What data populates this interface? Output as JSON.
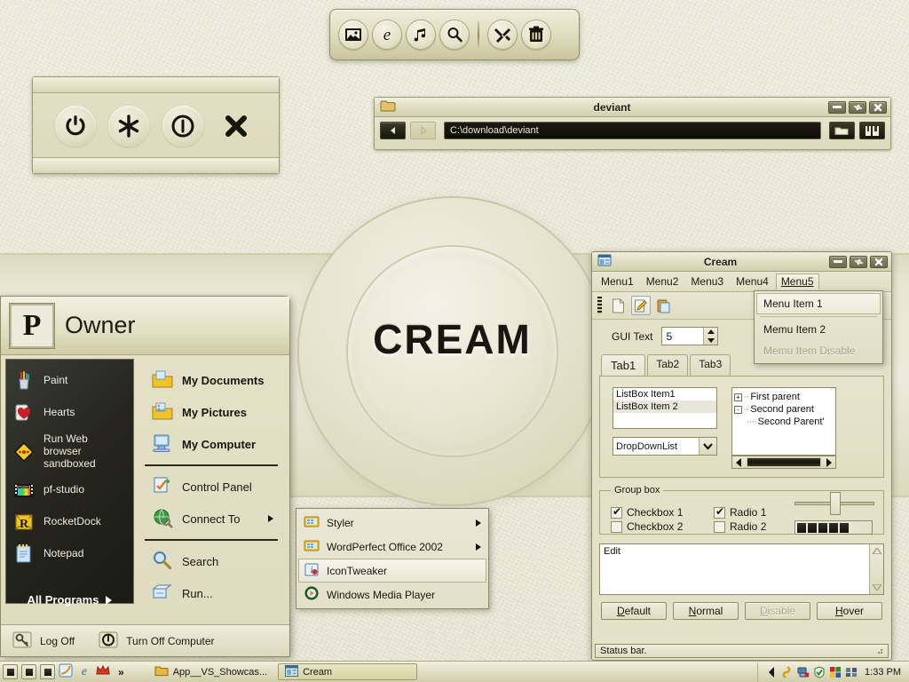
{
  "desktop": {
    "wallpaper_title": "CREAM",
    "bg_color": "#e8e6d2",
    "accent_color": "#d2cfac"
  },
  "dock": {
    "name": "icon-dock",
    "buttons": [
      {
        "name": "pictures-icon",
        "label": "Pictures"
      },
      {
        "name": "internet-explorer-icon",
        "label": "Internet"
      },
      {
        "name": "music-note-icon",
        "label": "Music"
      },
      {
        "name": "search-magnifier-icon",
        "label": "Search"
      },
      {
        "name": "tools-icon",
        "label": "Tools"
      },
      {
        "name": "trash-icon",
        "label": "Recycle Bin"
      }
    ]
  },
  "power_panel": {
    "buttons": [
      {
        "name": "power-icon",
        "label": "Shut Down"
      },
      {
        "name": "asterisk-icon",
        "label": "Hibernate"
      },
      {
        "name": "standby-icon",
        "label": "Stand By"
      },
      {
        "name": "close-x-icon",
        "label": "Cancel"
      }
    ]
  },
  "deviant_window": {
    "title": "deviant",
    "folder_icon": "folder-icon",
    "address_value": "C:\\download\\deviant",
    "back_label": "Back",
    "forward_label": "Forward",
    "folder_button": "folder-open-icon",
    "view_button": "view-icon",
    "caption": {
      "minimize": "minimize-icon",
      "restore": "restore-icon",
      "close": "close-icon"
    }
  },
  "start_menu": {
    "user_name": "Owner",
    "avatar_letter": "P",
    "left_items": [
      {
        "label": "Paint",
        "icon": "paint-cup-icon"
      },
      {
        "label": "Hearts",
        "icon": "hearts-card-icon"
      },
      {
        "label": "Run Web browser sandboxed",
        "icon": "sandbox-diamond-icon"
      },
      {
        "label": "pf-studio",
        "icon": "film-strip-icon"
      },
      {
        "label": "RocketDock",
        "icon": "rocketdock-r-icon"
      },
      {
        "label": "Notepad",
        "icon": "notepad-icon"
      }
    ],
    "all_programs_label": "All Programs",
    "right_items": [
      {
        "label": "My Documents",
        "icon": "my-documents-icon",
        "bold": true,
        "submenu": false
      },
      {
        "label": "My Pictures",
        "icon": "my-pictures-icon",
        "bold": true,
        "submenu": false
      },
      {
        "label": "My Computer",
        "icon": "my-computer-icon",
        "bold": true,
        "submenu": false
      },
      {
        "label": "Control Panel",
        "icon": "control-panel-icon",
        "bold": false,
        "submenu": false
      },
      {
        "label": "Connect To",
        "icon": "connect-to-globe-icon",
        "bold": false,
        "submenu": true
      },
      {
        "label": "Search",
        "icon": "search-magnifier-icon",
        "bold": false,
        "submenu": false
      },
      {
        "label": "Run...",
        "icon": "run-icon",
        "bold": false,
        "submenu": false
      }
    ],
    "footer": [
      {
        "label": "Log Off",
        "icon": "log-off-key-icon"
      },
      {
        "label": "Turn Off Computer",
        "icon": "turn-off-power-icon"
      }
    ]
  },
  "programs_flyout": {
    "items": [
      {
        "label": "Styler",
        "icon": "folder-programs-icon",
        "submenu": true,
        "selected": false
      },
      {
        "label": "WordPerfect Office 2002",
        "icon": "folder-programs-icon",
        "submenu": true,
        "selected": false
      },
      {
        "label": "IconTweaker",
        "icon": "icontweaker-icon",
        "submenu": false,
        "selected": true
      },
      {
        "label": "Windows Media Player",
        "icon": "media-player-icon",
        "submenu": false,
        "selected": false
      }
    ]
  },
  "cream_window": {
    "title": "Cream",
    "app_icon": "window-app-icon",
    "caption": {
      "minimize": "minimize-icon",
      "restore": "restore-icon",
      "close": "close-icon"
    },
    "menus": [
      {
        "label": "Menu1",
        "active": false
      },
      {
        "label": "Menu2",
        "active": false
      },
      {
        "label": "Menu3",
        "active": false
      },
      {
        "label": "Menu4",
        "active": false
      },
      {
        "label": "Menu5",
        "active": true
      }
    ],
    "dropdown": {
      "items": [
        {
          "label": "Menu Item 1",
          "state": "selected"
        },
        {
          "label": "Memu Item 2",
          "state": "normal"
        },
        {
          "label": "Memu Item Disable",
          "state": "disabled"
        }
      ]
    },
    "toolbar": [
      {
        "name": "new-document-icon",
        "active": false
      },
      {
        "name": "edit-pencil-icon",
        "active": true
      },
      {
        "name": "paste-clipboard-icon",
        "active": false
      }
    ],
    "gui_text_label": "GUI Text",
    "spinner_value": "5",
    "tabs": [
      {
        "label": "Tab1",
        "active": true
      },
      {
        "label": "Tab2",
        "active": false
      },
      {
        "label": "Tab3",
        "active": false
      }
    ],
    "listbox": [
      {
        "label": "ListBox Item1",
        "selected": false
      },
      {
        "label": "ListBox Item 2",
        "selected": true
      }
    ],
    "combobox": {
      "value": "DropDownList"
    },
    "tree": [
      {
        "label": "First parent",
        "expander": "+",
        "level": 0
      },
      {
        "label": "Second parent",
        "expander": "-",
        "level": 0
      },
      {
        "label": "Second Parent'",
        "expander": "",
        "level": 1
      }
    ],
    "groupbox": {
      "title": "Group box",
      "checkboxes": [
        {
          "label": "Checkbox 1",
          "checked": true
        },
        {
          "label": "Checkbox 2",
          "checked": false
        }
      ],
      "radios": [
        {
          "label": "Radio 1",
          "checked": true
        },
        {
          "label": "Radio 2",
          "checked": false
        }
      ]
    },
    "slider": {
      "value": 45
    },
    "progress": {
      "blocks": 5
    },
    "edit": {
      "value": "Edit"
    },
    "buttons": [
      {
        "label": "Default",
        "accel": "D",
        "rest": "efault",
        "state": "default"
      },
      {
        "label": "Normal",
        "accel": "N",
        "rest": "ormal",
        "state": "normal"
      },
      {
        "label": "Disable",
        "accel": "D",
        "rest": "isable",
        "state": "disabled"
      },
      {
        "label": "Hover",
        "accel": "H",
        "rest": "over",
        "state": "hover"
      }
    ],
    "status_text": "Status bar."
  },
  "taskbar": {
    "quick_launch": [
      {
        "name": "ql-button-1"
      },
      {
        "name": "ql-button-2"
      },
      {
        "name": "ql-button-3"
      },
      {
        "name": "quicklaunch-styler-icon"
      },
      {
        "name": "quicklaunch-ie-icon"
      },
      {
        "name": "quicklaunch-crown-icon"
      },
      {
        "name": "chevron-more-icon",
        "label": "»"
      }
    ],
    "tasks": [
      {
        "label": "App__VS_Showcas...",
        "icon": "folder-icon",
        "active": false
      },
      {
        "label": "Cream",
        "icon": "window-app-icon",
        "active": true
      }
    ],
    "tray": {
      "show_hidden": "chevron-left-icon",
      "icons": [
        {
          "name": "tray-swirl-icon"
        },
        {
          "name": "tray-network-disconnected-icon"
        },
        {
          "name": "tray-shield-icon"
        },
        {
          "name": "tray-colors-icon"
        },
        {
          "name": "tray-puzzle-icon"
        }
      ],
      "clock": "1:33 PM"
    }
  }
}
